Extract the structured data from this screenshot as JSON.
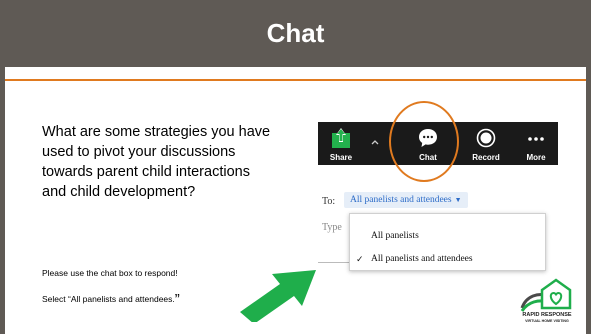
{
  "slide": {
    "title": "Chat",
    "question": "What are some strategies you have used to pivot your discussions towards parent child interactions and child development?",
    "instruction_1": "Please use the chat box to respond!",
    "instruction_2": "Select “All panelists and attendees.",
    "instruction_2_quote": "”"
  },
  "toolbar": {
    "share_label": "Share",
    "chat_label": "Chat",
    "record_label": "Record",
    "more_label": "More"
  },
  "chat_panel": {
    "to_label": "To:",
    "recipient_selected": "All panelists and attendees",
    "type_placeholder": "Type",
    "options": [
      {
        "label": "All panelists",
        "checked": false
      },
      {
        "label": "All panelists and attendees",
        "checked": true
      }
    ]
  },
  "logo": {
    "line1": "RAPID RESPONSE",
    "line2": "VIRTUAL HOME VISITING"
  },
  "colors": {
    "header_bg": "#5f5a55",
    "accent_orange": "#e07a1f",
    "toolbar_bg": "#1a1a1a",
    "share_green": "#23b14d",
    "arrow_green": "#1fae4b",
    "link_blue": "#2d6cc8"
  }
}
